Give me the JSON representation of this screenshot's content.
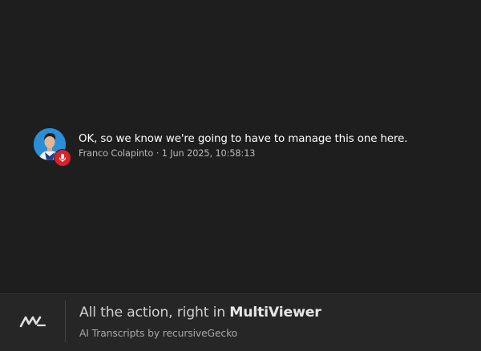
{
  "transcript": {
    "message": "OK, so we know we're going to have to manage this one here.",
    "speaker": "Franco Colapinto",
    "separator": " · ",
    "timestamp": "1 Jun 2025, 10:58:13",
    "avatar_icon": "driver-avatar",
    "badge_icon": "microphone-icon",
    "badge_color": "#d5232b",
    "avatar_color": "#2a8fd8"
  },
  "footer": {
    "logo_icon": "multiviewer-logo",
    "title_prefix": "All the action, right in ",
    "title_brand": "MultiViewer",
    "subtitle": "AI Transcripts by recursiveGecko"
  }
}
